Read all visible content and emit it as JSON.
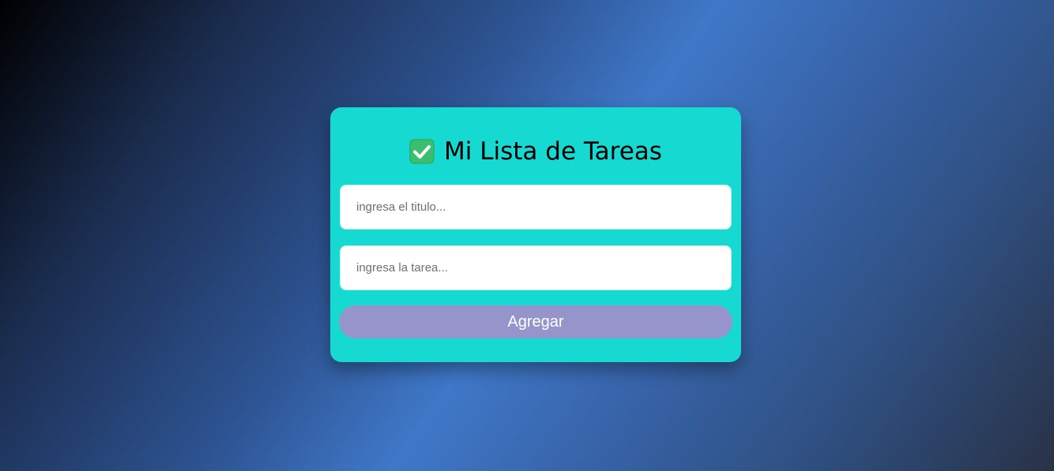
{
  "card": {
    "title": "Mi Lista de Tareas",
    "icon": "check-mark-icon"
  },
  "form": {
    "title_input": {
      "placeholder": "ingresa el titulo...",
      "value": ""
    },
    "task_input": {
      "placeholder": "ingresa la tarea...",
      "value": ""
    },
    "add_label": "Agregar"
  },
  "colors": {
    "card_background": "#16dad1",
    "button_background": "#9595cc",
    "check_icon": "#34c36b"
  }
}
